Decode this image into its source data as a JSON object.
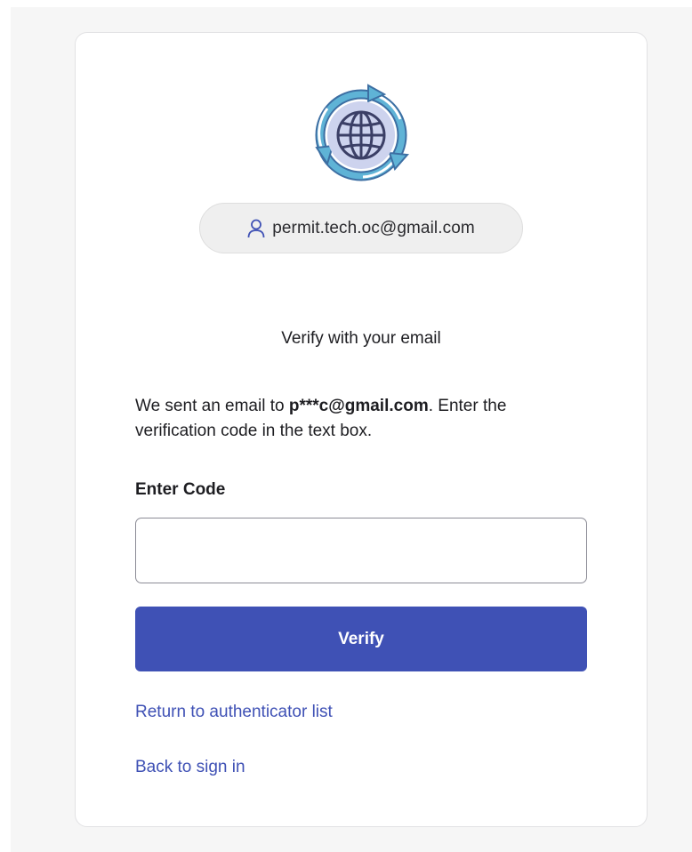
{
  "identity": {
    "email": "permit.tech.oc@gmail.com",
    "icon": "user-icon"
  },
  "logo": {
    "icon": "globe-sync-icon"
  },
  "challenge": {
    "title": "Verify with your email",
    "description_prefix": "We sent an email to ",
    "masked_email": "p***c@gmail.com",
    "description_suffix": ". Enter the verification code in the text box."
  },
  "form": {
    "code_label": "Enter Code",
    "code_value": "",
    "verify_label": "Verify"
  },
  "links": {
    "return_to_list": "Return to authenticator list",
    "back_to_sign_in": "Back to sign in"
  },
  "colors": {
    "accent": "#3f51b5",
    "logo_ring": "#4a9bc2",
    "logo_fill": "#cdd3ee"
  }
}
